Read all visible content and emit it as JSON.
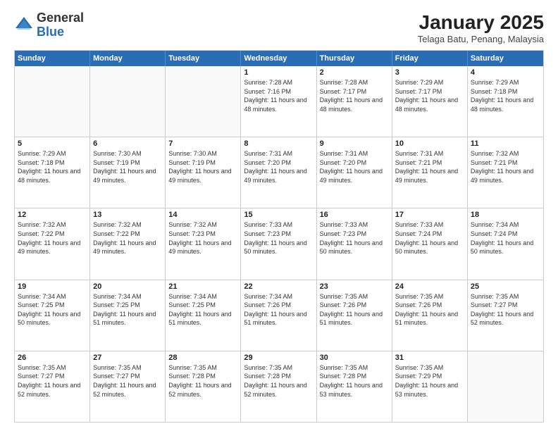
{
  "logo": {
    "general": "General",
    "blue": "Blue"
  },
  "header": {
    "month_year": "January 2025",
    "location": "Telaga Batu, Penang, Malaysia"
  },
  "days_of_week": [
    "Sunday",
    "Monday",
    "Tuesday",
    "Wednesday",
    "Thursday",
    "Friday",
    "Saturday"
  ],
  "weeks": [
    [
      {
        "day": "",
        "info": ""
      },
      {
        "day": "",
        "info": ""
      },
      {
        "day": "",
        "info": ""
      },
      {
        "day": "1",
        "info": "Sunrise: 7:28 AM\nSunset: 7:16 PM\nDaylight: 11 hours and 48 minutes."
      },
      {
        "day": "2",
        "info": "Sunrise: 7:28 AM\nSunset: 7:17 PM\nDaylight: 11 hours and 48 minutes."
      },
      {
        "day": "3",
        "info": "Sunrise: 7:29 AM\nSunset: 7:17 PM\nDaylight: 11 hours and 48 minutes."
      },
      {
        "day": "4",
        "info": "Sunrise: 7:29 AM\nSunset: 7:18 PM\nDaylight: 11 hours and 48 minutes."
      }
    ],
    [
      {
        "day": "5",
        "info": "Sunrise: 7:29 AM\nSunset: 7:18 PM\nDaylight: 11 hours and 48 minutes."
      },
      {
        "day": "6",
        "info": "Sunrise: 7:30 AM\nSunset: 7:19 PM\nDaylight: 11 hours and 49 minutes."
      },
      {
        "day": "7",
        "info": "Sunrise: 7:30 AM\nSunset: 7:19 PM\nDaylight: 11 hours and 49 minutes."
      },
      {
        "day": "8",
        "info": "Sunrise: 7:31 AM\nSunset: 7:20 PM\nDaylight: 11 hours and 49 minutes."
      },
      {
        "day": "9",
        "info": "Sunrise: 7:31 AM\nSunset: 7:20 PM\nDaylight: 11 hours and 49 minutes."
      },
      {
        "day": "10",
        "info": "Sunrise: 7:31 AM\nSunset: 7:21 PM\nDaylight: 11 hours and 49 minutes."
      },
      {
        "day": "11",
        "info": "Sunrise: 7:32 AM\nSunset: 7:21 PM\nDaylight: 11 hours and 49 minutes."
      }
    ],
    [
      {
        "day": "12",
        "info": "Sunrise: 7:32 AM\nSunset: 7:22 PM\nDaylight: 11 hours and 49 minutes."
      },
      {
        "day": "13",
        "info": "Sunrise: 7:32 AM\nSunset: 7:22 PM\nDaylight: 11 hours and 49 minutes."
      },
      {
        "day": "14",
        "info": "Sunrise: 7:32 AM\nSunset: 7:23 PM\nDaylight: 11 hours and 49 minutes."
      },
      {
        "day": "15",
        "info": "Sunrise: 7:33 AM\nSunset: 7:23 PM\nDaylight: 11 hours and 50 minutes."
      },
      {
        "day": "16",
        "info": "Sunrise: 7:33 AM\nSunset: 7:23 PM\nDaylight: 11 hours and 50 minutes."
      },
      {
        "day": "17",
        "info": "Sunrise: 7:33 AM\nSunset: 7:24 PM\nDaylight: 11 hours and 50 minutes."
      },
      {
        "day": "18",
        "info": "Sunrise: 7:34 AM\nSunset: 7:24 PM\nDaylight: 11 hours and 50 minutes."
      }
    ],
    [
      {
        "day": "19",
        "info": "Sunrise: 7:34 AM\nSunset: 7:25 PM\nDaylight: 11 hours and 50 minutes."
      },
      {
        "day": "20",
        "info": "Sunrise: 7:34 AM\nSunset: 7:25 PM\nDaylight: 11 hours and 51 minutes."
      },
      {
        "day": "21",
        "info": "Sunrise: 7:34 AM\nSunset: 7:25 PM\nDaylight: 11 hours and 51 minutes."
      },
      {
        "day": "22",
        "info": "Sunrise: 7:34 AM\nSunset: 7:26 PM\nDaylight: 11 hours and 51 minutes."
      },
      {
        "day": "23",
        "info": "Sunrise: 7:35 AM\nSunset: 7:26 PM\nDaylight: 11 hours and 51 minutes."
      },
      {
        "day": "24",
        "info": "Sunrise: 7:35 AM\nSunset: 7:26 PM\nDaylight: 11 hours and 51 minutes."
      },
      {
        "day": "25",
        "info": "Sunrise: 7:35 AM\nSunset: 7:27 PM\nDaylight: 11 hours and 52 minutes."
      }
    ],
    [
      {
        "day": "26",
        "info": "Sunrise: 7:35 AM\nSunset: 7:27 PM\nDaylight: 11 hours and 52 minutes."
      },
      {
        "day": "27",
        "info": "Sunrise: 7:35 AM\nSunset: 7:27 PM\nDaylight: 11 hours and 52 minutes."
      },
      {
        "day": "28",
        "info": "Sunrise: 7:35 AM\nSunset: 7:28 PM\nDaylight: 11 hours and 52 minutes."
      },
      {
        "day": "29",
        "info": "Sunrise: 7:35 AM\nSunset: 7:28 PM\nDaylight: 11 hours and 52 minutes."
      },
      {
        "day": "30",
        "info": "Sunrise: 7:35 AM\nSunset: 7:28 PM\nDaylight: 11 hours and 53 minutes."
      },
      {
        "day": "31",
        "info": "Sunrise: 7:35 AM\nSunset: 7:29 PM\nDaylight: 11 hours and 53 minutes."
      },
      {
        "day": "",
        "info": ""
      }
    ]
  ]
}
